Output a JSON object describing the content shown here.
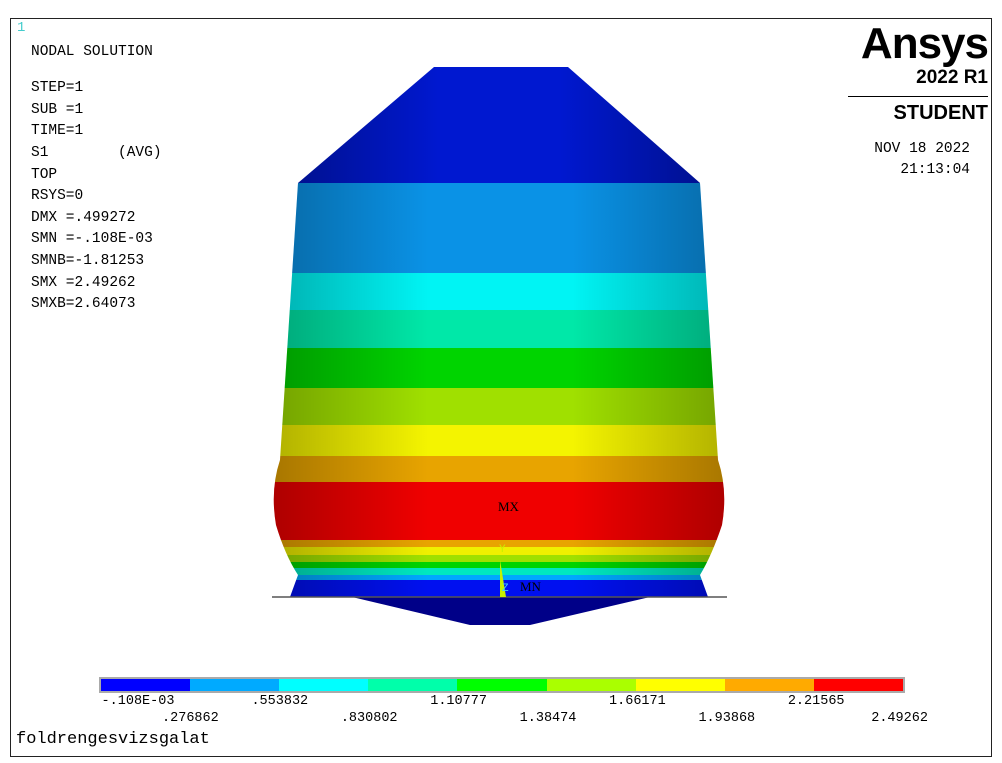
{
  "window_number": "1",
  "info_lines": [
    "NODAL SOLUTION",
    "",
    "STEP=1",
    "SUB =1",
    "TIME=1",
    "S1        (AVG)",
    "TOP",
    "RSYS=0",
    "DMX =.499272",
    "SMN =-.108E-03",
    "SMNB=-1.81253",
    "SMX =2.49262",
    "SMXB=2.64073"
  ],
  "logo": {
    "brand": "Ansys",
    "version": "2022 R1",
    "edition": "STUDENT"
  },
  "date": "NOV 18 2022",
  "time": "21:13:04",
  "markers": {
    "max": "MX",
    "min": "MN",
    "axis_y": "Y",
    "axis_z": "Z"
  },
  "legend": {
    "colors": [
      "#0000ff",
      "#00aaff",
      "#00ffff",
      "#00ffaa",
      "#00ff00",
      "#aaff00",
      "#ffff00",
      "#ffaa00",
      "#ff0000"
    ],
    "labels": [
      "-.108E-03",
      ".276862",
      ".553832",
      ".830802",
      "1.10777",
      "1.38474",
      "1.66171",
      "1.93868",
      "2.21565",
      "2.49262"
    ]
  },
  "model_title": "foldrengesvizsgalat"
}
